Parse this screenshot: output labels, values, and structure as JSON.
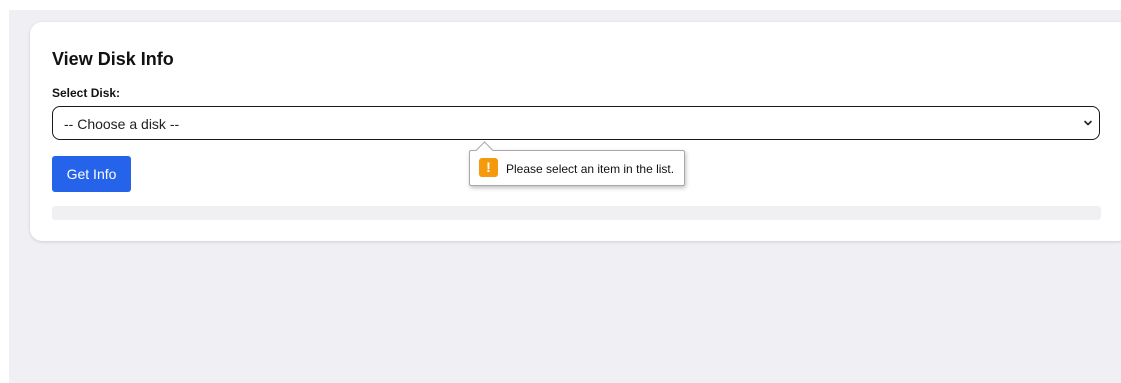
{
  "card": {
    "title": "View Disk Info",
    "select_label": "Select Disk:",
    "select": {
      "selected_value": "-- Choose a disk --"
    },
    "get_info_label": "Get Info"
  },
  "validation_tooltip": {
    "icon": "warning-icon",
    "icon_glyph": "!",
    "message": "Please select an item in the list."
  },
  "colors": {
    "accent": "#2563eb",
    "warning": "#f59a0c",
    "page_background": "#f0f0f4"
  }
}
